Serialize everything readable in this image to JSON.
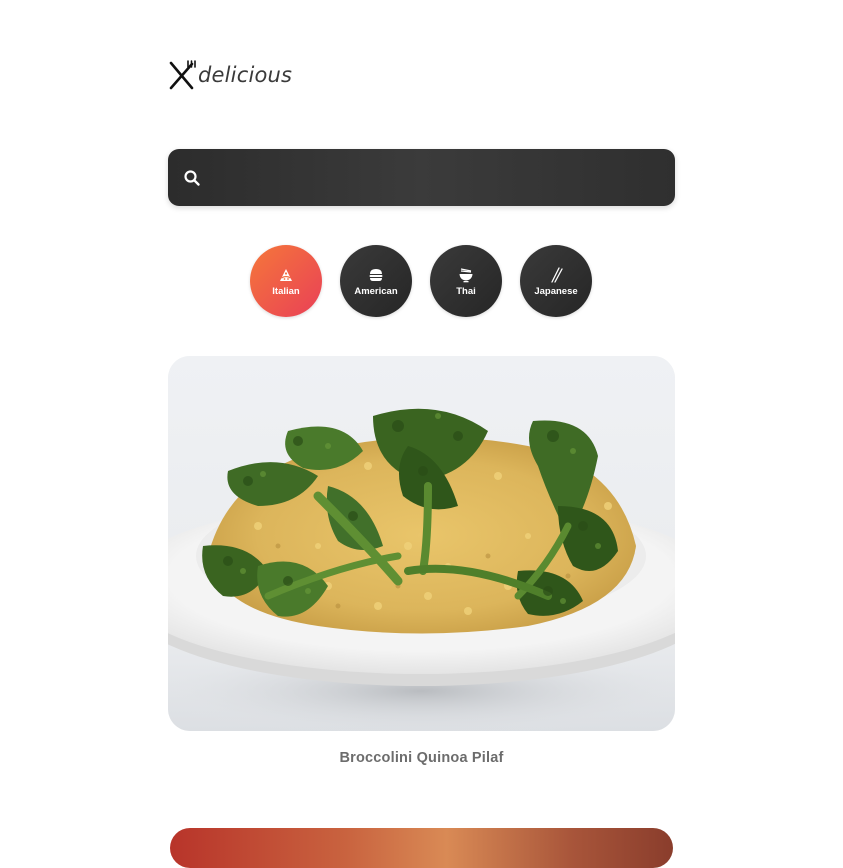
{
  "app": {
    "logo_text": "delicious"
  },
  "search": {
    "placeholder": "",
    "value": ""
  },
  "categories": [
    {
      "label": "Italian",
      "icon": "pizza-icon",
      "active": true
    },
    {
      "label": "American",
      "icon": "burger-icon",
      "active": false
    },
    {
      "label": "Thai",
      "icon": "noodle-bowl-icon",
      "active": false
    },
    {
      "label": "Japanese",
      "icon": "chopsticks-icon",
      "active": false
    }
  ],
  "recipes": [
    {
      "title": "Broccolini Quinoa Pilaf",
      "image": "broccolini-quinoa-pilaf-photo"
    }
  ],
  "colors": {
    "active_gradient_start": "#f5773a",
    "active_gradient_end": "#e94057",
    "dark": "#313131"
  }
}
